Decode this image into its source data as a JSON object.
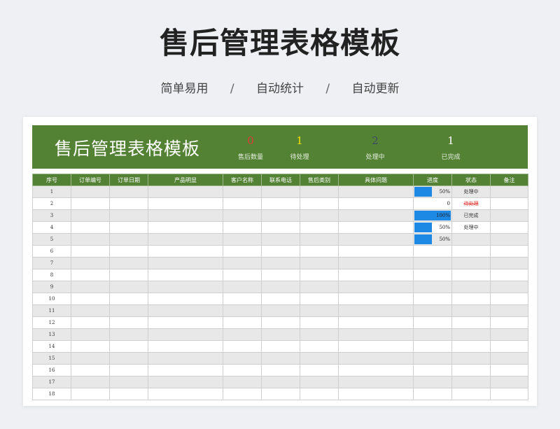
{
  "page": {
    "title": "售后管理表格模板",
    "subtitle_items": [
      "简单易用",
      "自动统计",
      "自动更新"
    ],
    "separator": "/"
  },
  "banner": {
    "title": "售后管理表格模板",
    "stats": [
      {
        "value": "0",
        "label": "售后数量",
        "color": "#e53935"
      },
      {
        "value": "1",
        "label": "待处理",
        "color": "#f4e100"
      },
      {
        "value": "2",
        "label": "处理中",
        "color": "#3b4a66"
      },
      {
        "value": "1",
        "label": "已完成",
        "color": "#ffffff"
      }
    ]
  },
  "table": {
    "headers": [
      "序号",
      "订单编号",
      "订单日期",
      "产品明显",
      "客户名称",
      "联系电话",
      "售后类别",
      "具体问题",
      "进度",
      "状态",
      "备注"
    ],
    "rows": [
      {
        "index": "1",
        "progress": 0.5,
        "progress_text": "50%",
        "status": "处理中"
      },
      {
        "index": "2",
        "progress": 0,
        "progress_text": "0",
        "status": "待处理"
      },
      {
        "index": "3",
        "progress": 1,
        "progress_text": "100%",
        "status": "已完成"
      },
      {
        "index": "4",
        "progress": 0.5,
        "progress_text": "50%",
        "status": "处理中"
      },
      {
        "index": "5",
        "progress": 0.5,
        "progress_text": "50%",
        "status": ""
      },
      {
        "index": "6"
      },
      {
        "index": "7"
      },
      {
        "index": "8"
      },
      {
        "index": "9"
      },
      {
        "index": "10"
      },
      {
        "index": "11"
      },
      {
        "index": "12"
      },
      {
        "index": "13"
      },
      {
        "index": "14"
      },
      {
        "index": "15"
      },
      {
        "index": "16"
      },
      {
        "index": "17"
      },
      {
        "index": "18"
      }
    ],
    "strike_status": "待处理"
  },
  "colors": {
    "header_green": "#548235",
    "progress_blue": "#1e88e5",
    "stripe_gray": "#e8e8e8"
  }
}
